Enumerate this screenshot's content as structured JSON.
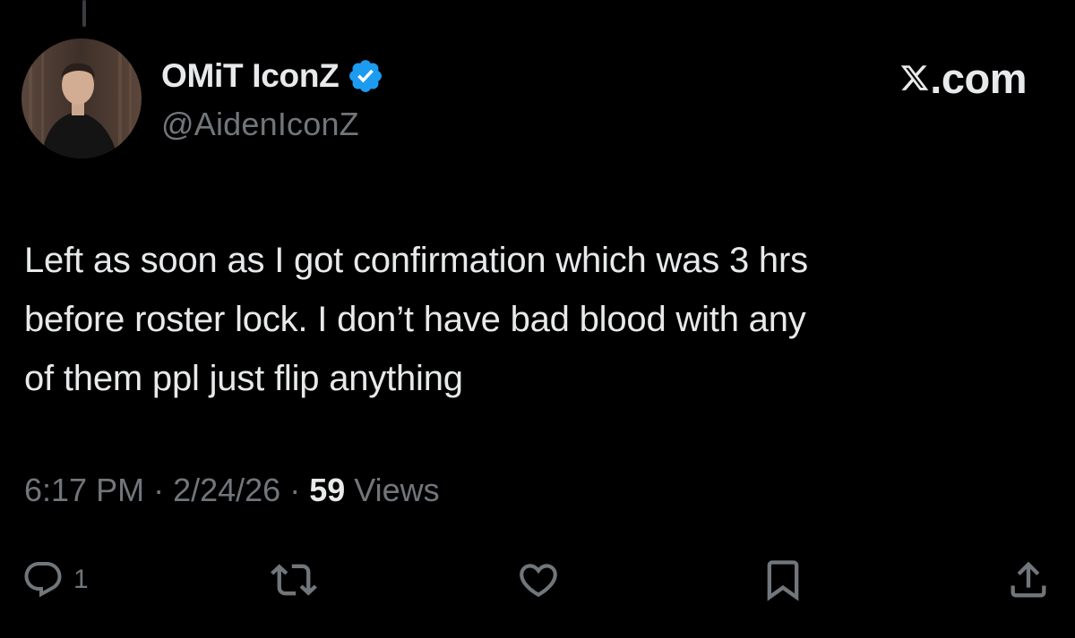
{
  "author": {
    "display_name": "OMiT IconZ",
    "handle": "@AidenIconZ",
    "verified": true,
    "avatar_icon": "profile-photo"
  },
  "brand": {
    "icon": "x-logo-icon",
    "text": ".com"
  },
  "tweet": {
    "lines": [
      "Left as soon as I got confirmation which was 3 hrs",
      "before roster lock. I don’t have bad blood with any",
      "of them ppl just flip anything"
    ]
  },
  "meta": {
    "time": "6:17 PM",
    "sep1": " · ",
    "date": "2/24/26",
    "sep2": " · ",
    "views_count": "59",
    "views_label": " Views"
  },
  "actions": {
    "reply": {
      "icon": "reply-icon",
      "count": "1"
    },
    "retweet": {
      "icon": "retweet-icon"
    },
    "like": {
      "icon": "heart-icon"
    },
    "bookmark": {
      "icon": "bookmark-icon"
    },
    "share": {
      "icon": "share-icon"
    }
  },
  "colors": {
    "background": "#000000",
    "text_primary": "#e7e9ea",
    "text_secondary": "#71767b",
    "verified_blue": "#1d9bf0"
  }
}
